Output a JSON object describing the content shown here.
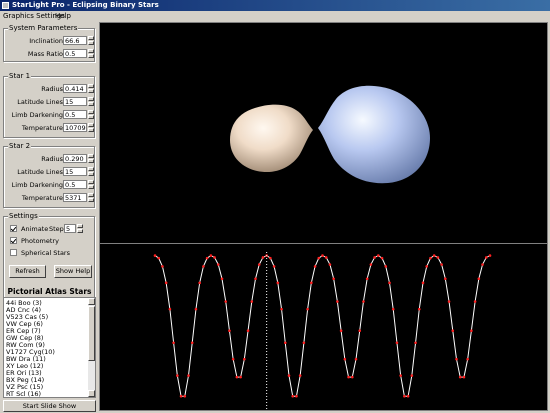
{
  "window": {
    "title": "StarLight Pro - Eclipsing Binary Stars"
  },
  "menu": {
    "items": [
      "Graphics Settings",
      "Help"
    ]
  },
  "system_parameters": {
    "legend": "System Parameters",
    "fields": [
      {
        "label": "Inclination",
        "value": "66.6"
      },
      {
        "label": "Mass Ratio",
        "value": "0.5"
      }
    ]
  },
  "star1": {
    "legend": "Star 1",
    "fields": [
      {
        "label": "Radius",
        "value": "0.414"
      },
      {
        "label": "Latitude Lines",
        "value": "15"
      },
      {
        "label": "Limb Darkening",
        "value": "0.5"
      },
      {
        "label": "Temperature",
        "value": "10709"
      }
    ]
  },
  "star2": {
    "legend": "Star 2",
    "fields": [
      {
        "label": "Radius",
        "value": "0.290"
      },
      {
        "label": "Latitude Lines",
        "value": "15"
      },
      {
        "label": "Limb Darkening",
        "value": "0.5"
      },
      {
        "label": "Temperature",
        "value": "5371"
      }
    ]
  },
  "settings": {
    "legend": "Settings",
    "animate_label": "Animate",
    "step_label": "Step =",
    "step_value": "5",
    "photometry_label": "Photometry",
    "spherical_label": "Spherical Stars",
    "animate_checked": true,
    "photometry_checked": true,
    "spherical_checked": false,
    "refresh_label": "Refresh",
    "show_help_label": "Show Help"
  },
  "atlas": {
    "title": "Pictorial Atlas Stars",
    "items": [
      "44i Boo (3)",
      "AD Cnc (4)",
      "V523 Cas (5)",
      "VW Cep (6)",
      "ER Cep (7)",
      "GW Cep (8)",
      "RW Com (9)",
      "V1727 Cyg(10)",
      "BW Dra (11)",
      "XY Leo (12)",
      "ER Ori (13)",
      "BX Peg (14)",
      "VZ Psc (15)",
      "RT Scl (16)"
    ],
    "slide_show_label": "Start Slide Show"
  },
  "colors": {
    "star_primary": "#b8c8f0",
    "star_secondary": "#f0dcc8",
    "curve_point": "#ff2020",
    "curve_line": "#ffffff"
  },
  "light_curve": {
    "phase_cursor": 1.0,
    "phase_span": 3,
    "points_per_cycle": 30,
    "primary_min_depth": 0.98,
    "secondary_min_depth": 0.85
  }
}
